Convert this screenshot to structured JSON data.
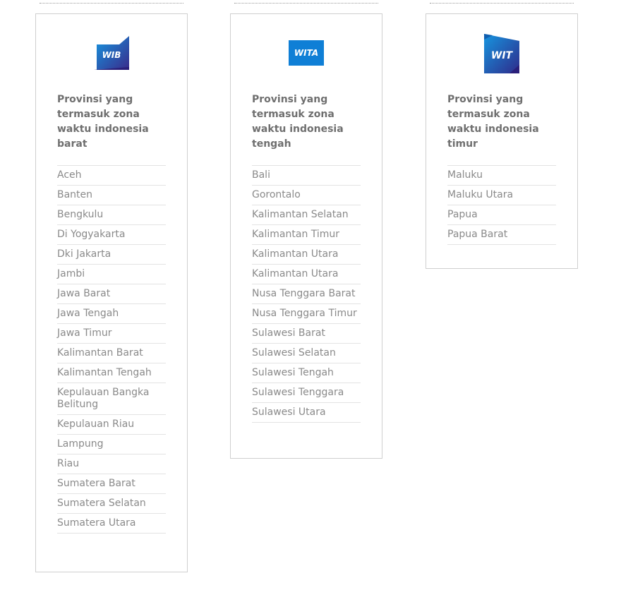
{
  "zones": [
    {
      "id": "wib",
      "badge": "WIB",
      "heading": "Provinsi yang termasuk zona waktu indonesia barat",
      "provinces": [
        "Aceh",
        "Banten",
        "Bengkulu",
        "Di Yogyakarta",
        "Dki Jakarta",
        "Jambi",
        "Jawa Barat",
        "Jawa Tengah",
        "Jawa Timur",
        "Kalimantan Barat",
        "Kalimantan Tengah",
        "Kepulauan Bangka Belitung",
        "Kepulauan Riau",
        "Lampung",
        "Riau",
        "Sumatera Barat",
        "Sumatera Selatan",
        "Sumatera Utara"
      ]
    },
    {
      "id": "wita",
      "badge": "WITA",
      "heading": "Provinsi yang termasuk zona waktu indonesia tengah",
      "provinces": [
        "Bali",
        "Gorontalo",
        "Kalimantan Selatan",
        "Kalimantan Timur",
        "Kalimantan Utara",
        "Kalimantan Utara",
        "Nusa Tenggara Barat",
        "Nusa Tenggara Timur",
        "Sulawesi Barat",
        "Sulawesi Selatan",
        "Sulawesi Tengah",
        "Sulawesi Tenggara",
        "Sulawesi Utara"
      ]
    },
    {
      "id": "wit",
      "badge": "WIT",
      "heading": "Provinsi yang termasuk zona waktu indonesia timur",
      "provinces": [
        "Maluku",
        "Maluku Utara",
        "Papua",
        "Papua Barat"
      ]
    }
  ],
  "colors": {
    "badge_blue": "#0f7fd6",
    "badge_dark": "#2a2f8f",
    "badge_text": "#ffffff"
  }
}
